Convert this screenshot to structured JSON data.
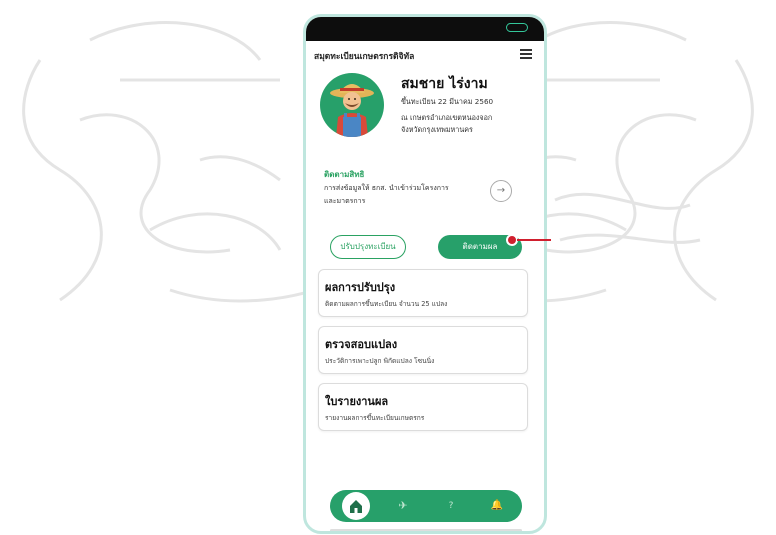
{
  "app": {
    "title": "สมุดทะเบียนเกษตรกรดิจิทัล"
  },
  "profile": {
    "name": "สมชาย  ไร่งาม",
    "line1": "ขึ้นทะเบียน 22 มีนาคม 2560",
    "line2": "ณ เกษตรอำเภอเขตหนองจอก",
    "line3": "จังหวัดกรุงเทพมหานคร"
  },
  "follow": {
    "title": "ติดตามสิทธิ",
    "desc_line1": "การส่งข้อมูลให้ ธกส. นำเข้าร่วมโครงการ",
    "desc_line2": "และมาตรการ",
    "arrow": "→"
  },
  "buttons": {
    "update": "ปรับปรุงทะเบียน",
    "track": "ติดตามผล"
  },
  "cards": [
    {
      "title": "ผลการปรับปรุง",
      "subtitle": "ติดตามผลการขึ้นทะเบียน จำนวน 25 แปลง"
    },
    {
      "title": "ตรวจสอบแปลง",
      "subtitle": "ประวัติการเพาะปลูก พิกัดแปลง โซนนิ่ง"
    },
    {
      "title": "ใบรายงานผล",
      "subtitle": "รายงานผลการขึ้นทะเบียนเกษตรกร"
    }
  ],
  "nav": {
    "send_glyph": "✈",
    "help_glyph": "?",
    "bell_glyph": "🔔"
  },
  "colors": {
    "accent": "#27a06a",
    "pointer": "#d01f2e",
    "phone_border": "#bfe6de"
  },
  "icons": [
    "menu-icon",
    "farmer-avatar",
    "arrow-right-icon",
    "home-icon",
    "send-icon",
    "help-icon",
    "bell-icon"
  ]
}
